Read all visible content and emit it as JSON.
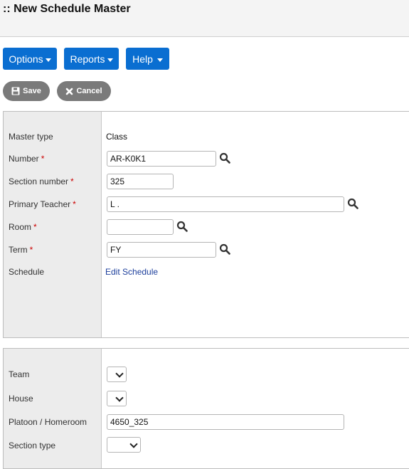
{
  "page": {
    "title": ":: New Schedule Master"
  },
  "menubar": {
    "options": "Options",
    "reports": "Reports",
    "help": "Help"
  },
  "actions": {
    "save": "Save",
    "cancel": "Cancel"
  },
  "form1": {
    "master_type_label": "Master type",
    "master_type_value": "Class",
    "number_label": "Number",
    "number_value": "AR-K0K1",
    "section_number_label": "Section number",
    "section_number_value": "325",
    "primary_teacher_label": "Primary Teacher",
    "primary_teacher_value": "L .",
    "room_label": "Room",
    "room_value": "",
    "term_label": "Term",
    "term_value": "FY",
    "schedule_label": "Schedule",
    "schedule_link": "Edit Schedule",
    "required_marker": "*"
  },
  "form2": {
    "team_label": "Team",
    "house_label": "House",
    "platoon_label": "Platoon / Homeroom",
    "platoon_value": "4650_325",
    "section_type_label": "Section type"
  },
  "colors": {
    "accent": "#0a6ed1",
    "action_button": "#7a7a7a",
    "label_column": "#ececec",
    "required": "#cc0000",
    "link": "#1d3f9c"
  },
  "icons": [
    "caret-down-icon",
    "save-icon",
    "close-icon",
    "search-icon",
    "chevron-down-icon"
  ]
}
